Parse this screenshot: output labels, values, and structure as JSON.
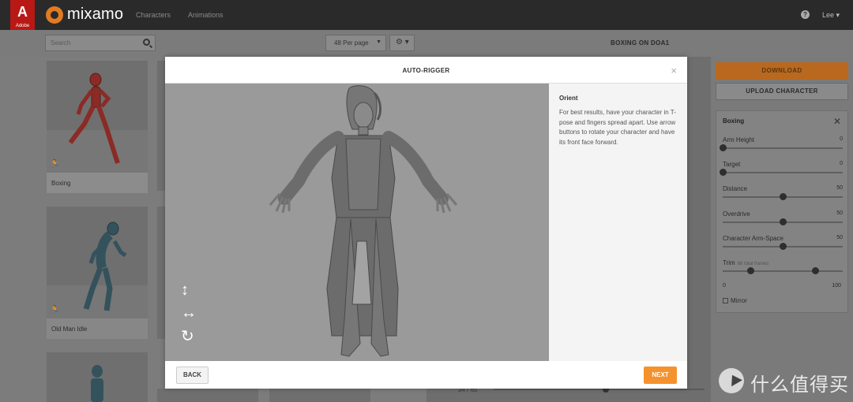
{
  "brand": {
    "adobe_label": "Adobe",
    "app_name": "mixamo"
  },
  "nav": [
    {
      "label": "Characters"
    },
    {
      "label": "Animations"
    }
  ],
  "header_right": {
    "help_glyph": "?",
    "user": "Lee"
  },
  "search": {
    "placeholder": "Search"
  },
  "toolbar": {
    "per_page": "48 Per page",
    "settings_icon": "gear-icon"
  },
  "asset_title": "BOXING ON DOA1",
  "grid": {
    "cards": [
      {
        "label": "Boxing",
        "selected": true
      },
      {
        "label": "Old Man Idle",
        "selected": false
      }
    ]
  },
  "right_panel": {
    "download_label": "DOWNLOAD",
    "upload_label": "UPLOAD CHARACTER",
    "settings_title": "Boxing",
    "params": [
      {
        "name": "Arm Height",
        "value": "0",
        "level": 0
      },
      {
        "name": "Target",
        "value": "0",
        "level": 0
      },
      {
        "name": "Distance",
        "value": "50",
        "level": 0.5
      },
      {
        "name": "Overdrive",
        "value": "50",
        "level": 0.5
      },
      {
        "name": "Character Arm-Space",
        "value": "50",
        "level": 0.5
      }
    ],
    "trim": {
      "name": "Trim",
      "sub": "66 total frames",
      "min": "0",
      "max": "100",
      "start": 0.23,
      "end": 0.77
    },
    "mirror_label": "Mirror"
  },
  "timeline": {
    "frame_text": "34 / 65",
    "position": 0.53
  },
  "modal": {
    "title": "AUTO-RIGGER",
    "close_glyph": "×",
    "info_heading": "Orient",
    "info_text": "For best results, have your character in T-pose and fingers spread apart. Use arrow buttons to rotate your character and have its front face forward.",
    "back_label": "BACK",
    "next_label": "NEXT",
    "controls": [
      "↕",
      "↔",
      "↻"
    ]
  },
  "watermark": {
    "text": "什么值得买"
  },
  "colors": {
    "accent": "#f5922e",
    "topbar": "#2a2a2a",
    "adobe_red": "#b81915",
    "stage": "#9a9a9a"
  }
}
